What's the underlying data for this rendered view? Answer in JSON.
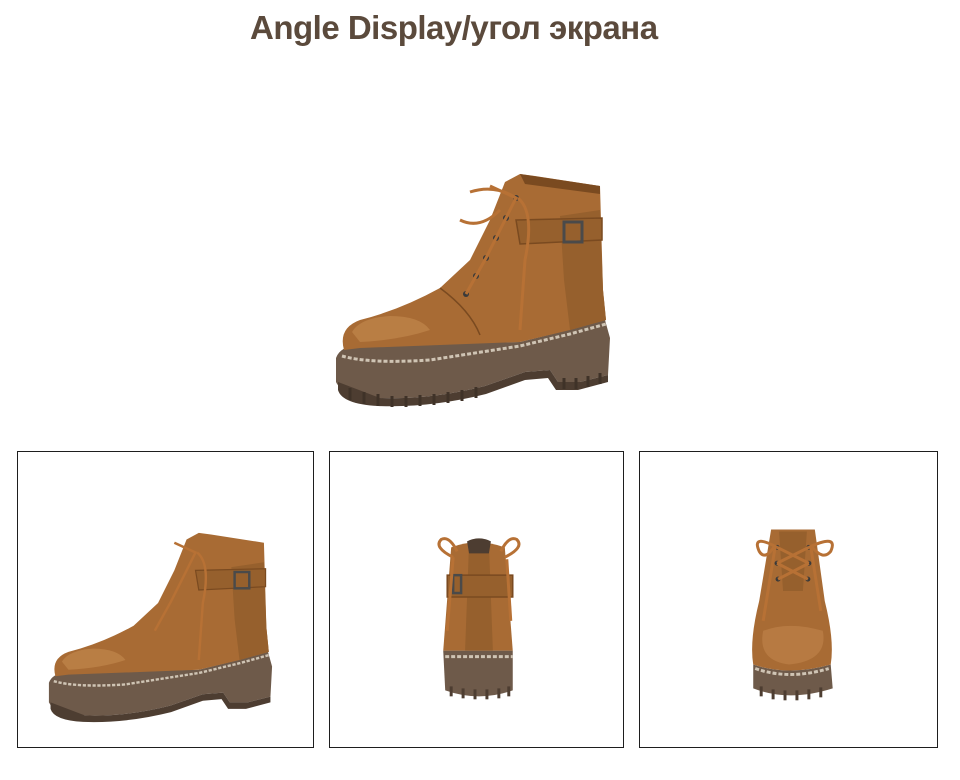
{
  "header": {
    "title": "Angle Display/угол экрана"
  },
  "product": {
    "main_view": {
      "icon": "ankle-boot-side-view",
      "angle": "three-quarter side"
    },
    "thumbnails": [
      {
        "icon": "ankle-boot-side-view",
        "angle": "side"
      },
      {
        "icon": "ankle-boot-back-view",
        "angle": "back"
      },
      {
        "icon": "ankle-boot-front-view",
        "angle": "front"
      }
    ]
  },
  "colors": {
    "title": "#5b4a3c",
    "leather": "#a86b34",
    "leather_dark": "#7a4a20",
    "leather_light": "#c58a50",
    "sole": "#6e5a4a",
    "sole_dark": "#4d3d31",
    "lace": "#b77135",
    "buckle": "#4a4a4a",
    "thumb_border": "#1e1e1e"
  }
}
